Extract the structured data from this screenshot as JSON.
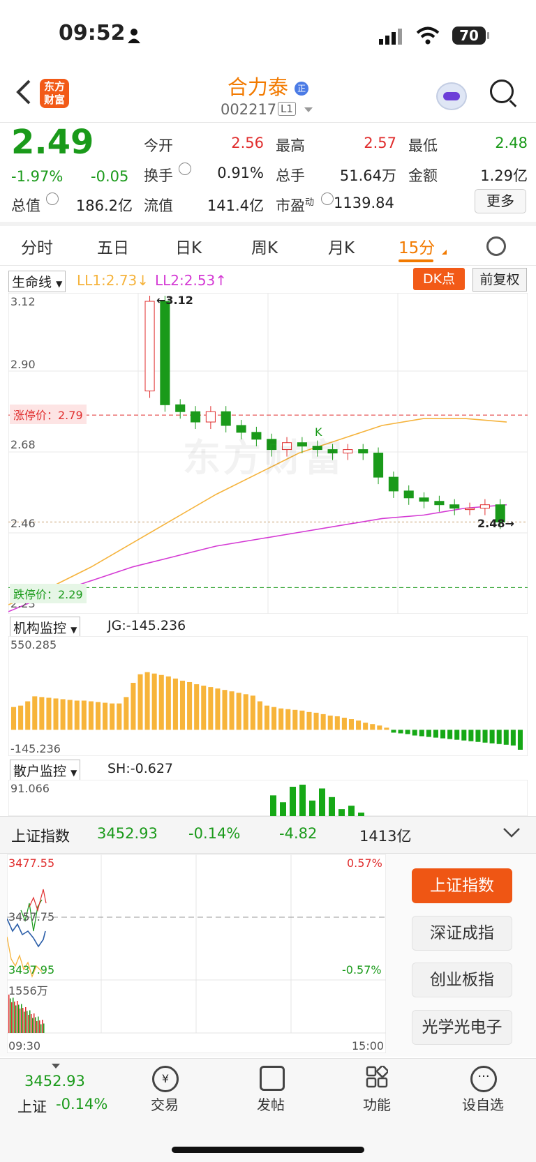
{
  "status": {
    "time": "09:52",
    "battery": "70"
  },
  "header": {
    "name": "合力泰",
    "code": "002217",
    "level": "L1",
    "logo_top": "东方",
    "logo_bottom": "财富"
  },
  "quote": {
    "price": "2.49",
    "change_pct": "-1.97%",
    "change": "-0.05",
    "open_label": "今开",
    "open": "2.56",
    "high_label": "最高",
    "high": "2.57",
    "low_label": "最低",
    "low": "2.48",
    "turnover_label": "换手",
    "turnover": "0.91%",
    "volume_label": "总手",
    "volume": "51.64万",
    "amount_label": "金额",
    "amount": "1.29亿",
    "mktcap_label": "总值",
    "mktcap": "186.2亿",
    "float_label": "流值",
    "float_cap": "141.4亿",
    "pe_label": "市盈",
    "pe_sup": "动",
    "pe": "1139.84",
    "more": "更多"
  },
  "tabs": [
    "分时",
    "五日",
    "日K",
    "周K",
    "月K",
    "15分"
  ],
  "active_tab": "15分",
  "kline": {
    "indicator": "生命线",
    "ll1": "LL1:2.73↓",
    "ll2": "LL2:2.53↑",
    "dk_button": "DK点",
    "fq_button": "前复权",
    "y_ticks": [
      "3.12",
      "2.90",
      "2.68",
      "2.46",
      "2.23"
    ],
    "high_marker": "←3.12",
    "low_marker": "2.48→",
    "limit_up": "涨停价：2.79",
    "limit_down": "跌停价：2.29",
    "k_label": "K",
    "watermark": "东方财富"
  },
  "chart_data": [
    {
      "type": "candlestick",
      "title": "15分",
      "ylim": [
        2.23,
        3.12
      ],
      "series": [
        {
          "name": "LL1",
          "values": [
            2.24,
            2.29,
            2.35,
            2.42,
            2.49,
            2.56,
            2.62,
            2.68,
            2.72,
            2.76,
            2.78,
            2.78,
            2.77
          ]
        },
        {
          "name": "LL2",
          "values": [
            2.22,
            2.27,
            2.31,
            2.35,
            2.38,
            2.41,
            2.43,
            2.45,
            2.47,
            2.49,
            2.5,
            2.52,
            2.53
          ]
        }
      ],
      "candles_close": [
        3.12,
        2.82,
        2.8,
        2.77,
        2.8,
        2.76,
        2.74,
        2.72,
        2.69,
        2.71,
        2.7,
        2.69,
        2.68,
        2.69,
        2.68,
        2.61,
        2.57,
        2.55,
        2.54,
        2.53,
        2.52,
        2.52,
        2.53,
        2.48
      ]
    },
    {
      "type": "bar",
      "title": "机构监控",
      "label": "JG:-145.236",
      "ylim": [
        -145.236,
        550.285
      ],
      "values": [
        160,
        170,
        200,
        235,
        230,
        225,
        220,
        215,
        210,
        205,
        205,
        200,
        195,
        190,
        185,
        185,
        230,
        330,
        390,
        405,
        395,
        385,
        375,
        360,
        345,
        335,
        320,
        310,
        300,
        290,
        280,
        270,
        260,
        250,
        240,
        200,
        170,
        160,
        150,
        145,
        140,
        135,
        125,
        120,
        110,
        100,
        95,
        85,
        75,
        65,
        50,
        40,
        30,
        15,
        -20,
        -25,
        -30,
        -40,
        -45,
        -50,
        -55,
        -60,
        -65,
        -70,
        -75,
        -80,
        -85,
        -90,
        -95,
        -100,
        -105,
        -110,
        -140
      ]
    },
    {
      "type": "bar",
      "title": "散户监控",
      "label": "SH:-0.627",
      "ylim": [
        0,
        91.066
      ],
      "values": [
        60,
        40,
        85,
        91,
        45,
        80,
        55,
        20,
        30,
        10
      ]
    }
  ],
  "jg": {
    "indicator": "机构监控",
    "value": "JG:-145.236",
    "top": "550.285",
    "bottom": "-145.236"
  },
  "sh": {
    "indicator": "散户监控",
    "value": "SH:-0.627",
    "top": "91.066"
  },
  "index": {
    "name": "上证指数",
    "price": "3452.93",
    "pct": "-0.14%",
    "change": "-4.82",
    "amount": "1413亿",
    "y_high": "3477.55",
    "y_mid": "3457.75",
    "y_low": "3437.95",
    "pct_high": "0.57%",
    "pct_low": "-0.57%",
    "vol": "1556万",
    "t_start": "09:30",
    "t_end": "15:00",
    "buttons": [
      "上证指数",
      "深证成指",
      "创业板指",
      "光学光电子"
    ]
  },
  "nav": {
    "index_price": "3452.93",
    "index_name": "上证",
    "index_pct": "-0.14%",
    "items": [
      "交易",
      "发帖",
      "功能",
      "设自选"
    ]
  }
}
